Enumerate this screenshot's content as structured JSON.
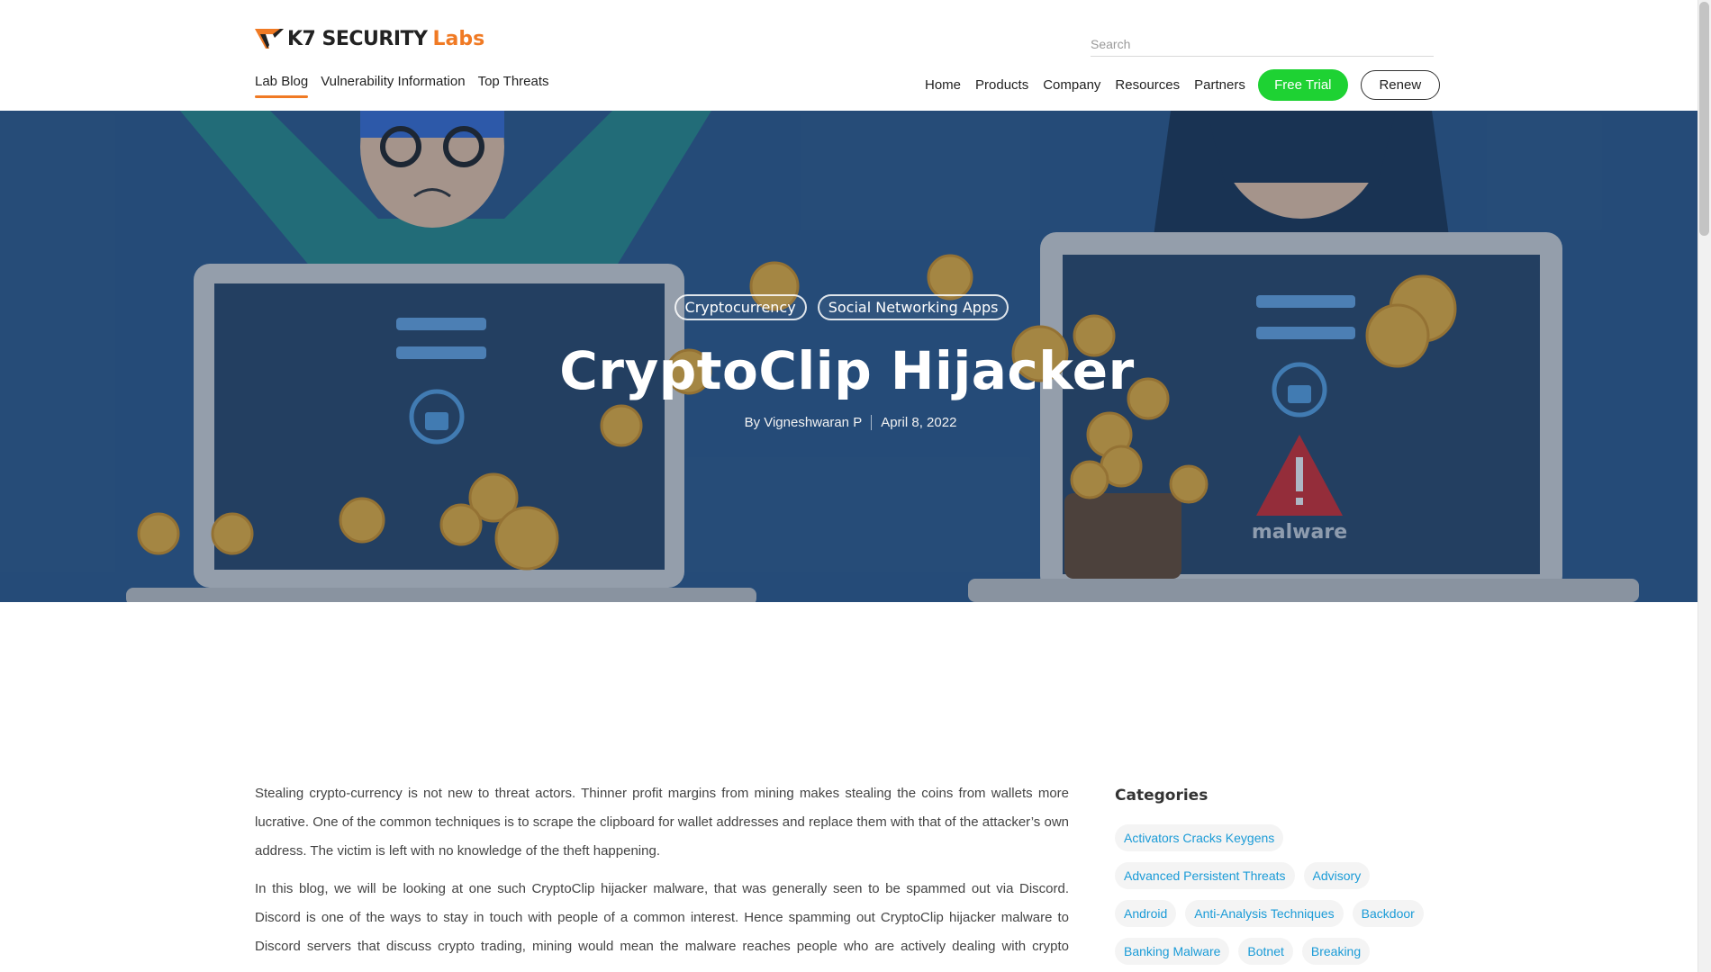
{
  "brand": {
    "name": "K7 SECURITY",
    "suffix": "Labs",
    "accent": "#f07a24"
  },
  "search": {
    "placeholder": "Search"
  },
  "left_nav": [
    {
      "label": "Lab Blog",
      "active": true
    },
    {
      "label": "Vulnerability Information",
      "active": false
    },
    {
      "label": "Top Threats",
      "active": false
    }
  ],
  "right_nav": [
    {
      "label": "Home"
    },
    {
      "label": "Products"
    },
    {
      "label": "Company"
    },
    {
      "label": "Resources"
    },
    {
      "label": "Partners"
    }
  ],
  "buttons": {
    "free_trial": "Free Trial",
    "renew": "Renew",
    "trial_color": "#1ed233"
  },
  "hero": {
    "tags": [
      "Cryptocurrency",
      "Social Networking Apps"
    ],
    "title": "CryptoClip Hijacker",
    "author": "By Vigneshwaran P",
    "date": "April 8, 2022",
    "malware_label": "malware"
  },
  "article": {
    "paragraphs": [
      "Stealing crypto-currency is not new to threat actors. Thinner profit margins from mining makes stealing the coins from wallets more lucrative. One of the common techniques is to scrape the clipboard for wallet addresses and replace them with that of the attacker’s own address. The victim is left with no knowledge of the theft happening.",
      "In this blog, we will be looking at one such CryptoClip hijacker malware, that was generally seen to be spammed out via Discord. Discord is one of the ways to stay in touch with people of a common interest. Hence spamming out CryptoClip hijacker malware to Discord servers that discuss crypto trading, mining would mean the malware reaches people who are actively dealing with crypto currency."
    ]
  },
  "sidebar": {
    "heading": "Categories",
    "categories": [
      "Activators Cracks Keygens",
      "Advanced Persistent Threats",
      "Advisory",
      "Android",
      "Anti-Analysis Techniques",
      "Backdoor",
      "Banking Malware",
      "Botnet",
      "Breaking"
    ]
  }
}
